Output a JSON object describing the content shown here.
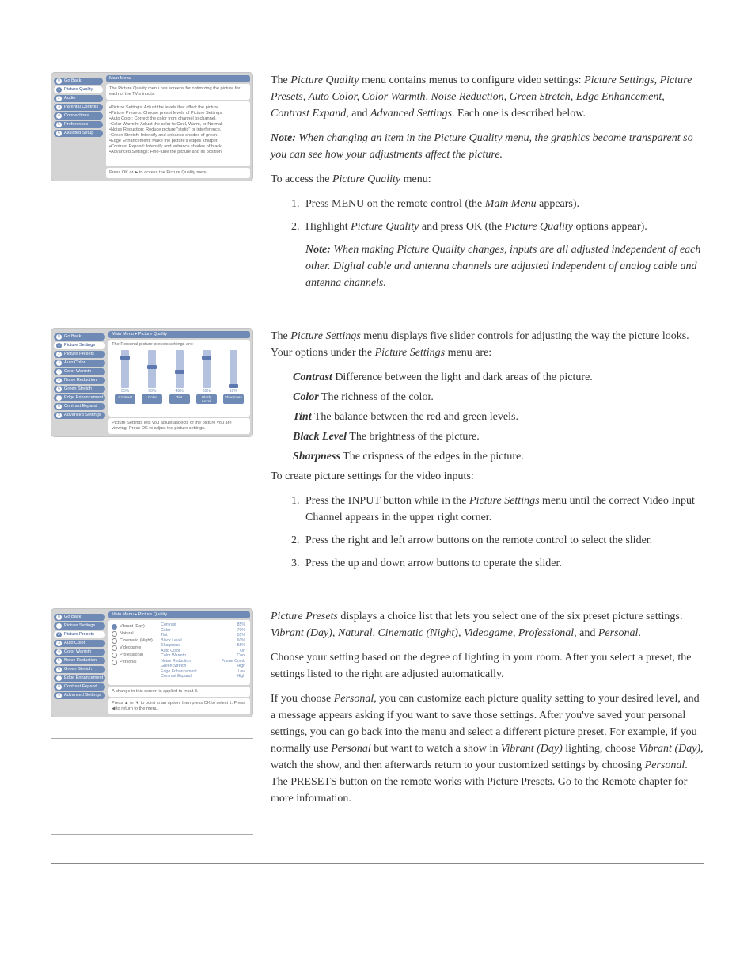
{
  "fig1": {
    "title": "Main Menu",
    "sidebar": [
      {
        "num": "0",
        "label": "Go Back",
        "active": false
      },
      {
        "num": "1",
        "label": "Picture Quality",
        "active": true
      },
      {
        "num": "2",
        "label": "Audio",
        "active": false
      },
      {
        "num": "3",
        "label": "Parental Controls",
        "active": false
      },
      {
        "num": "4",
        "label": "Connections",
        "active": false
      },
      {
        "num": "5",
        "label": "Preferences",
        "active": false
      },
      {
        "num": "6",
        "label": "Assisted Setup",
        "active": false
      }
    ],
    "intro": "The Picture Quality menu has screens for optimizing the picture for each of the TV's inputs:",
    "bullets": [
      "Picture Settings: Adjust the levels that affect the picture.",
      "Picture Presets: Choose preset levels of Picture Settings.",
      "Auto Color: Correct the color from channel to channel.",
      "Color Warmth: Adjust the color to Cool, Warm, or Normal.",
      "Noise Reduction: Reduce picture \"static\" or interference.",
      "Green Stretch: Intensify and enhance shades of green.",
      "Edge Enhancement: Make the picture's edges sharper.",
      "Contrast Expand: Intensify and enhance shades of black.",
      "Advanced Settings: Fine-tune the picture and its position."
    ],
    "footer": "Press OK or ▶ to access the Picture Quality menu."
  },
  "fig2": {
    "title": "Main Menu ▸ Picture Quality",
    "sidebar": [
      {
        "num": "0",
        "label": "Go Back",
        "active": false
      },
      {
        "num": "1",
        "label": "Picture Settings",
        "active": true
      },
      {
        "num": "2",
        "label": "Picture Presets",
        "active": false
      },
      {
        "num": "3",
        "label": "Auto Color",
        "active": false
      },
      {
        "num": "4",
        "label": "Color Warmth",
        "active": false
      },
      {
        "num": "5",
        "label": "Noise Reduction",
        "active": false
      },
      {
        "num": "6",
        "label": "Green Stretch",
        "active": false
      },
      {
        "num": "7",
        "label": "Edge Enhancement",
        "active": false
      },
      {
        "num": "8",
        "label": "Contrast Expand",
        "active": false
      },
      {
        "num": "9",
        "label": "Advanced Settings",
        "active": false
      }
    ],
    "intro": "The Personal picture presets settings are:",
    "sliders": [
      {
        "label": "Contrast",
        "pct": "85%",
        "thumb": 7
      },
      {
        "label": "Color",
        "pct": "60%",
        "thumb": 19
      },
      {
        "label": "Tint",
        "pct": "48%",
        "thumb": 25
      },
      {
        "label": "Black Level",
        "pct": "85%",
        "thumb": 7
      },
      {
        "label": "Sharpness",
        "pct": "10%",
        "thumb": 43
      }
    ],
    "footer": "Picture Settings lets you adjust aspects of the picture you are viewing. Press OK to adjust the picture settings."
  },
  "fig3": {
    "title": "Main Menu ▸ Picture Quality",
    "sidebar": [
      {
        "num": "0",
        "label": "Go Back",
        "active": false
      },
      {
        "num": "1",
        "label": "Picture Settings",
        "active": false
      },
      {
        "num": "2",
        "label": "Picture Presets",
        "active": true
      },
      {
        "num": "3",
        "label": "Auto Color",
        "active": false
      },
      {
        "num": "4",
        "label": "Color Warmth",
        "active": false
      },
      {
        "num": "5",
        "label": "Noise Reduction",
        "active": false
      },
      {
        "num": "6",
        "label": "Green Stretch",
        "active": false
      },
      {
        "num": "7",
        "label": "Edge Enhancement",
        "active": false
      },
      {
        "num": "8",
        "label": "Contrast Expand",
        "active": false
      },
      {
        "num": "9",
        "label": "Advanced Settings",
        "active": false
      }
    ],
    "radios": [
      "Vibrant (Day)",
      "Natural",
      "Cinematic (Night)",
      "Videogame",
      "Professional",
      "Personal"
    ],
    "selected": 0,
    "values": [
      {
        "k": "Contrast",
        "v": "85%"
      },
      {
        "k": "Color",
        "v": "70%"
      },
      {
        "k": "Tint",
        "v": "55%"
      },
      {
        "k": "Black Level",
        "v": "60%"
      },
      {
        "k": "Sharpness",
        "v": "55%"
      },
      {
        "k": "Auto Color",
        "v": "On"
      },
      {
        "k": "Color Warmth",
        "v": "Cool"
      },
      {
        "k": "Noise Reduction",
        "v": "Frame Comb"
      },
      {
        "k": "Green Stretch",
        "v": "High"
      },
      {
        "k": "Edge Enhancement",
        "v": "Low"
      },
      {
        "k": "Contrast Expand",
        "v": "High"
      }
    ],
    "note": "A change in this screen is applied to Input 3.",
    "footer": "Press ▲ or ▼ to point to an option, then press OK to select it. Press ◀ to return to the menu."
  },
  "body": {
    "s1_p1_a": "The ",
    "s1_p1_b": "Picture Quality",
    "s1_p1_c": " menu contains menus to configure video settings: ",
    "s1_p1_d": "Picture Settings, Picture Presets, Auto Color, Color Warmth, Noise Reduction, Green Stretch, Edge Enhancement, Contrast Expand,",
    "s1_p1_e": " and ",
    "s1_p1_f": "Advanced Settings",
    "s1_p1_g": ". Each one is described below.",
    "s1_note_label": "Note:",
    "s1_note": " When changing an item in the Picture Quality menu, the graphics become transparent so you can see how your adjustments affect the picture.",
    "s1_p2_a": "To access the ",
    "s1_p2_b": "Picture Quality",
    "s1_p2_c": " menu:",
    "s1_li1_a": "Press MENU on the remote control (the ",
    "s1_li1_b": "Main Menu",
    "s1_li1_c": " appears).",
    "s1_li2_a": "Highlight ",
    "s1_li2_b": "Picture Quality",
    "s1_li2_c": " and press OK (the ",
    "s1_li2_d": "Picture Quality",
    "s1_li2_e": " options appear).",
    "s1_note2_label": "Note:",
    "s1_note2": " When making Picture Quality changes, inputs are all adjusted independent of each other. Digital cable and antenna channels are adjusted independent of analog cable and antenna channels.",
    "s2_p1_a": "The ",
    "s2_p1_b": "Picture Settings",
    "s2_p1_c": " menu displays five slider controls for adjusting the way the picture looks. Your options under the ",
    "s2_p1_d": "Picture Settings",
    "s2_p1_e": " menu are:",
    "def_contrast_l": "Contrast",
    "def_contrast_t": "   Difference between the light and dark areas of the picture.",
    "def_color_l": "Color",
    "def_color_t": "   The richness of the color.",
    "def_tint_l": "Tint",
    "def_tint_t": "   The balance between the red and green levels.",
    "def_black_l": "Black Level",
    "def_black_t": "   The brightness of the picture.",
    "def_sharp_l": "Sharpness",
    "def_sharp_t": "   The crispness of the edges in the picture.",
    "s2_p2": "To create picture settings for the video inputs:",
    "s2_li1_a": "Press the INPUT button while in the ",
    "s2_li1_b": "Picture Settings",
    "s2_li1_c": " menu until the correct Video Input Channel appears in the upper right corner.",
    "s2_li2": "Press the right and left arrow buttons on the remote control to select the slider.",
    "s2_li3": "Press the up and down arrow buttons to operate the slider.",
    "s3_p1_a": "Picture Presets",
    "s3_p1_b": " displays a choice list that lets you select one of the six preset picture settings: ",
    "s3_p1_c": "Vibrant (Day), Natural, Cinematic (Night), Videogame, Professional,",
    "s3_p1_d": " and ",
    "s3_p1_e": "Personal",
    "s3_p1_f": ".",
    "s3_p2": "Choose your setting based on the degree of lighting in your room. After you select a preset, the settings listed to the right are adjusted automatically.",
    "s3_p3_a": "If you choose ",
    "s3_p3_b": "Personal",
    "s3_p3_c": ", you can customize each picture quality setting to your desired level, and a message appears asking if you want to save those settings. After you've saved your personal settings, you can go back into the menu and select a different picture preset. For example, if you normally use ",
    "s3_p3_d": "Personal",
    "s3_p3_e": " but want to watch a show in ",
    "s3_p3_f": "Vibrant (Day)",
    "s3_p3_g": " lighting, choose ",
    "s3_p3_h": "Vibrant (Day)",
    "s3_p3_i": ", watch the show, and then afterwards return to your customized settings by choosing ",
    "s3_p3_j": "Personal",
    "s3_p3_k": ". The PRESETS button on the remote works with Picture Presets. Go to the Remote chapter for more information."
  }
}
